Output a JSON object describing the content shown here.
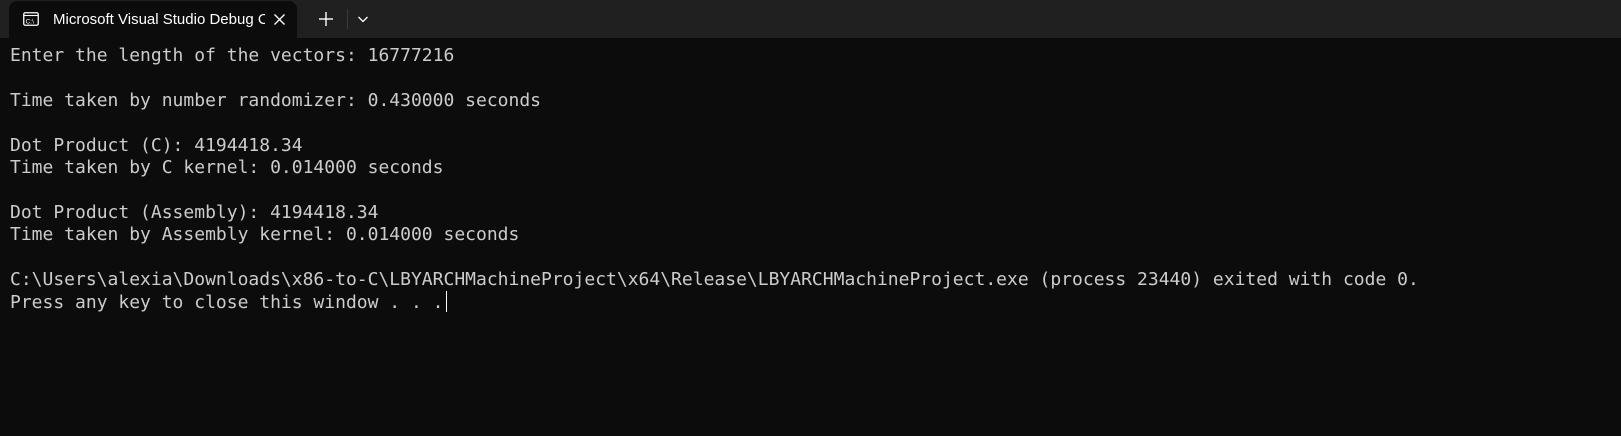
{
  "window": {
    "tab": {
      "icon": "console-icon",
      "title": "Microsoft Visual Studio Debug Console",
      "close_icon": "close-icon"
    },
    "new_tab_icon": "plus-icon",
    "dropdown_icon": "chevron-down-icon"
  },
  "console": {
    "lines": [
      "Enter the length of the vectors: 16777216",
      "",
      "Time taken by number randomizer: 0.430000 seconds",
      "",
      "Dot Product (C): 4194418.34",
      "Time taken by C kernel: 0.014000 seconds",
      "",
      "Dot Product (Assembly): 4194418.34",
      "Time taken by Assembly kernel: 0.014000 seconds",
      "",
      "C:\\Users\\alexia\\Downloads\\x86-to-C\\LBYARCHMachineProject\\x64\\Release\\LBYARCHMachineProject.exe (process 23440) exited with code 0.",
      "Press any key to close this window . . ."
    ]
  },
  "colors": {
    "titlebar_bg": "#202020",
    "tab_bg": "#0c0c0c",
    "console_bg": "#0c0c0c",
    "console_text": "#cccccc",
    "tab_text": "#ffffff"
  }
}
